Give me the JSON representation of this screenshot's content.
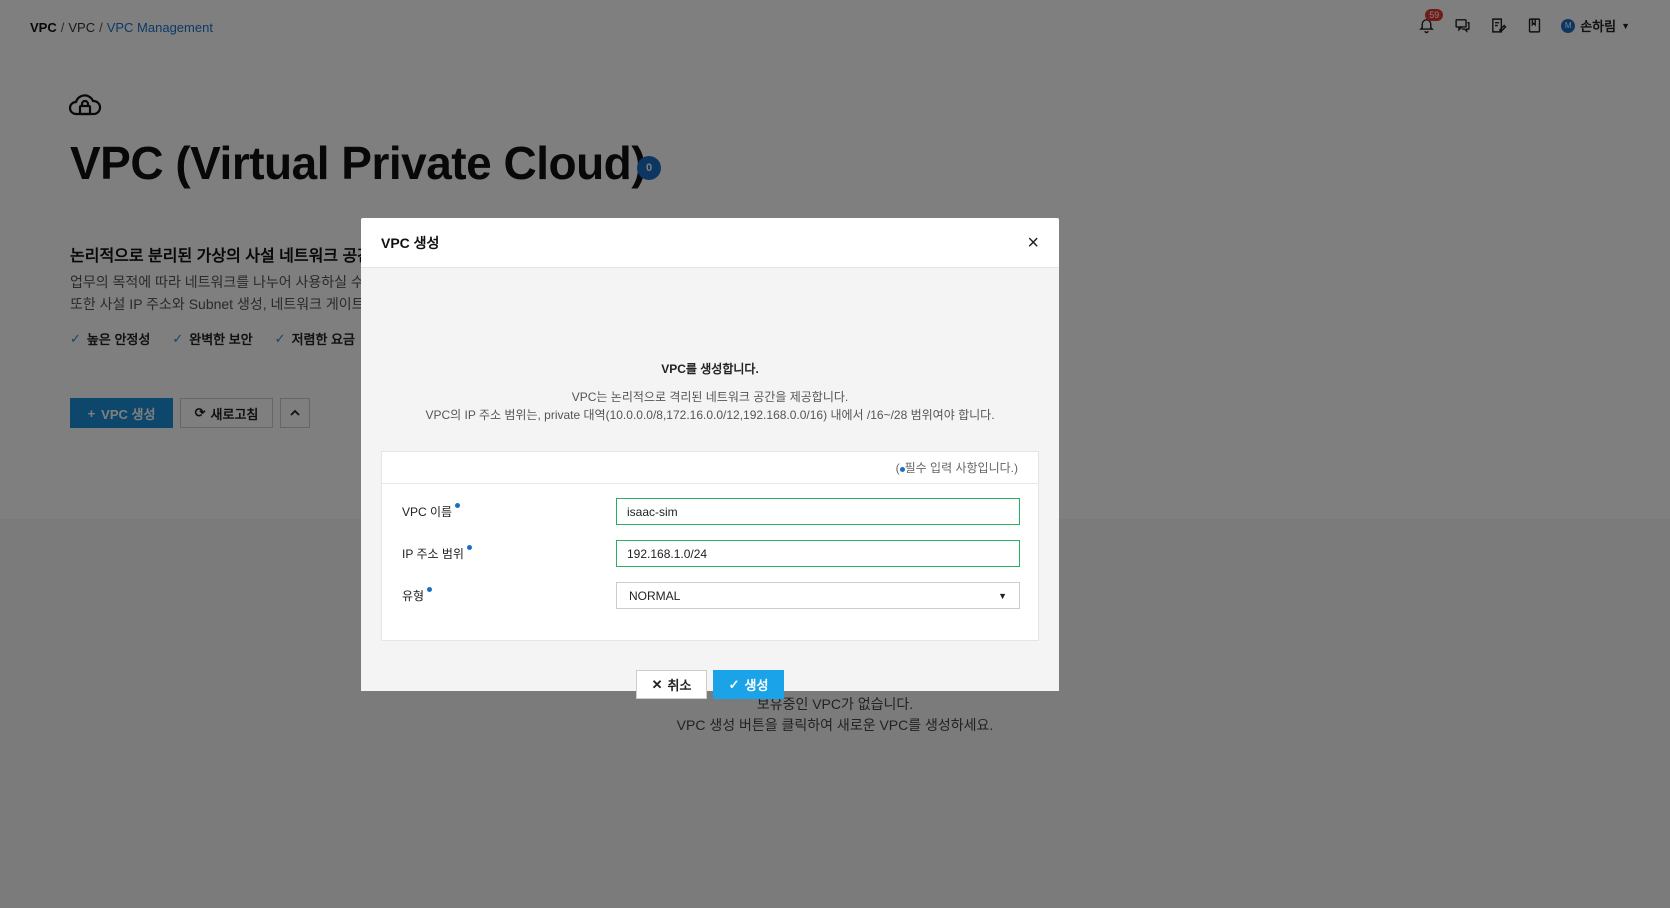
{
  "breadcrumb": {
    "first": "VPC",
    "sep1": "/",
    "mid": "VPC",
    "sep2": "/",
    "last": "VPC Management"
  },
  "topbar": {
    "notification_count": "59",
    "user_avatar_letter": "M",
    "user_name": "손하림",
    "icons": [
      "bell-icon",
      "chat-icon",
      "edit-note-icon",
      "book-icon"
    ]
  },
  "page": {
    "title": "VPC (Virtual Private Cloud)",
    "count": "0",
    "subtitle": "논리적으로 분리된 가상의 사설 네트워크 공간",
    "desc1": "업무의 목적에 따라 네트워크를 나누어 사용하실 수 있",
    "desc2": "또한 사설 IP 주소와 Subnet 생성, 네트워크 게이트웨",
    "features": [
      "높은 안정성",
      "완벽한 보안",
      "저렴한 요금"
    ],
    "create_label": "VPC 생성",
    "refresh_label": "새로고침",
    "empty_line1": "보유중인 VPC가 없습니다.",
    "empty_line2": "VPC 생성 버튼을 클릭하여 새로운 VPC를 생성하세요."
  },
  "modal": {
    "title": "VPC 생성",
    "close": "×",
    "heading": "VPC를 생성합니다.",
    "desc1": "VPC는 논리적으로 격리된 네트워크 공간을 제공합니다.",
    "desc2": "VPC의 IP 주소 범위는, private 대역(10.0.0.0/8,172.16.0.0/12,192.168.0.0/16) 내에서 /16~/28 범위여야 합니다.",
    "required_prefix": "(",
    "required_note": "필수 입력 사항입니다.)",
    "fields": {
      "name_label": "VPC 이름",
      "name_value": "isaac-sim",
      "ip_label": "IP 주소 범위",
      "ip_value": "192.168.1.0/24",
      "type_label": "유형",
      "type_value": "NORMAL"
    },
    "cancel_label": "취소",
    "submit_label": "생성"
  },
  "colors": {
    "accent": "#1a8fd6",
    "submit": "#1aa3e8",
    "valid_border": "#27ae60",
    "badge": "#e53935"
  }
}
